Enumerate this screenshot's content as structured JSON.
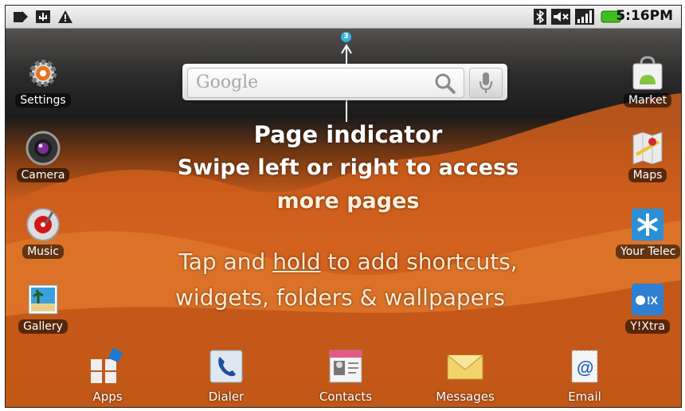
{
  "status_bar": {
    "time": "5:16PM",
    "left_icons": [
      "notification-icon",
      "usb-icon",
      "warning-icon"
    ],
    "right_icons": [
      "bluetooth-icon",
      "mute-icon",
      "signal-icon",
      "battery-icon"
    ]
  },
  "page_indicator": {
    "page": "3"
  },
  "search": {
    "placeholder": "Google"
  },
  "overlay": {
    "title": "Page indicator",
    "line2": "Swipe left or right to access",
    "line3": "more pages",
    "tap_before": "Tap and ",
    "tap_hold": "hold",
    "tap_after": " to add shortcuts,",
    "tap_line2": "widgets, folders & wallpapers"
  },
  "left_apps": [
    {
      "label": "Settings",
      "icon": "gear-icon"
    },
    {
      "label": "Camera",
      "icon": "camera-icon"
    },
    {
      "label": "Music",
      "icon": "music-icon"
    },
    {
      "label": "Gallery",
      "icon": "gallery-icon"
    }
  ],
  "right_apps": [
    {
      "label": "Market",
      "icon": "market-icon"
    },
    {
      "label": "Maps",
      "icon": "maps-icon"
    },
    {
      "label": "Your Telec",
      "icon": "asterisk-icon"
    },
    {
      "label": "Y!Xtra",
      "icon": "yahoo-icon"
    }
  ],
  "dock": [
    {
      "label": "Apps",
      "icon": "apps-grid-icon"
    },
    {
      "label": "Dialer",
      "icon": "phone-icon"
    },
    {
      "label": "Contacts",
      "icon": "contacts-icon"
    },
    {
      "label": "Messages",
      "icon": "envelope-icon"
    },
    {
      "label": "Email",
      "icon": "email-icon"
    }
  ],
  "colors": {
    "accent_blue": "#39b3e0",
    "battery_green": "#3fbf1f"
  }
}
